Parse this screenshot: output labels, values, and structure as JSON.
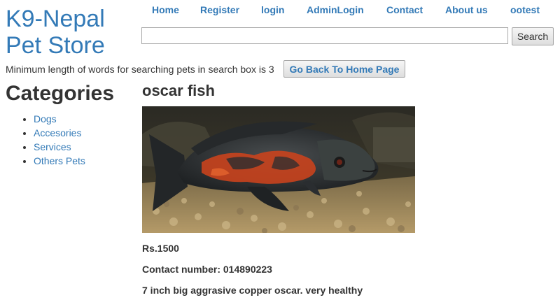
{
  "site": {
    "title_line1": "K9-Nepal",
    "title_line2": "Pet Store"
  },
  "nav": {
    "items": [
      "Home",
      "Register",
      "login",
      "AdminLogin",
      "Contact",
      "About us",
      "ootest"
    ]
  },
  "search": {
    "value": "",
    "placeholder": "",
    "button_label": "Search"
  },
  "notice": "Minimum length of words for searching pets in search box is 3",
  "home_button_label": "Go Back To Home Page",
  "categories": {
    "heading": "Categories",
    "items": [
      "Dogs",
      "Accesories",
      "Services",
      "Others Pets"
    ]
  },
  "product": {
    "name": "oscar fish",
    "price": "Rs.1500",
    "contact": "Contact number: 014890223",
    "description": "7 inch big aggrasive copper oscar. very healthy"
  },
  "colors": {
    "link": "#337ab7",
    "text": "#333333"
  }
}
